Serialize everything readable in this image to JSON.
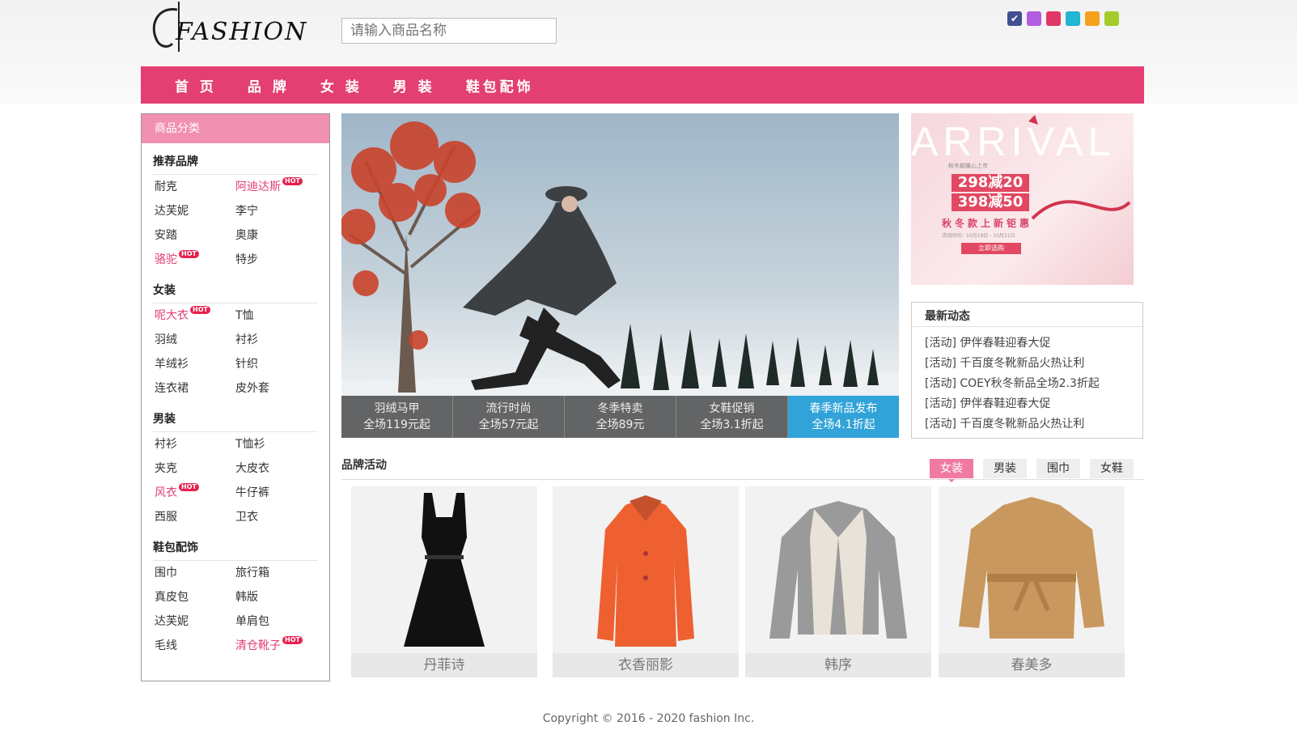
{
  "logo": {
    "text": "FASHION"
  },
  "search": {
    "placeholder": "请输入商品名称"
  },
  "skins": [
    {
      "name": "navy",
      "color": "#3f4f8f"
    },
    {
      "name": "purple",
      "color": "#b35de0"
    },
    {
      "name": "pink",
      "color": "#e23769"
    },
    {
      "name": "cyan",
      "color": "#21b6d1"
    },
    {
      "name": "orange",
      "color": "#f5a11d"
    },
    {
      "name": "green",
      "color": "#a3cc2a"
    }
  ],
  "nav": [
    "首 页",
    "品 牌",
    "女 装",
    "男 装",
    "鞋包配饰"
  ],
  "sidebar": {
    "heading": "商品分类",
    "categories": [
      {
        "title": "推荐品牌",
        "items": [
          {
            "label": "耐克",
            "hot": false
          },
          {
            "label": "阿迪达斯",
            "hot": true
          },
          {
            "label": "达芙妮",
            "hot": false
          },
          {
            "label": "李宁",
            "hot": false
          },
          {
            "label": "安踏",
            "hot": false
          },
          {
            "label": "奥康",
            "hot": false
          },
          {
            "label": "骆驼",
            "hot": true
          },
          {
            "label": "特步",
            "hot": false
          }
        ]
      },
      {
        "title": "女装",
        "items": [
          {
            "label": "呢大衣",
            "hot": true
          },
          {
            "label": "T恤",
            "hot": false
          },
          {
            "label": "羽绒",
            "hot": false
          },
          {
            "label": "衬衫",
            "hot": false
          },
          {
            "label": "羊绒衫",
            "hot": false
          },
          {
            "label": "针织",
            "hot": false
          },
          {
            "label": "连衣裙",
            "hot": false
          },
          {
            "label": "皮外套",
            "hot": false
          }
        ]
      },
      {
        "title": "男装",
        "items": [
          {
            "label": "衬衫",
            "hot": false
          },
          {
            "label": "T恤衫",
            "hot": false
          },
          {
            "label": "夹克",
            "hot": false
          },
          {
            "label": "大皮衣",
            "hot": false
          },
          {
            "label": "风衣",
            "hot": true
          },
          {
            "label": "牛仔裤",
            "hot": false
          },
          {
            "label": "西服",
            "hot": false
          },
          {
            "label": "卫衣",
            "hot": false
          }
        ]
      },
      {
        "title": "鞋包配饰",
        "items": [
          {
            "label": "围巾",
            "hot": false
          },
          {
            "label": "旅行箱",
            "hot": false
          },
          {
            "label": "真皮包",
            "hot": false
          },
          {
            "label": "韩版",
            "hot": false
          },
          {
            "label": "达芙妮",
            "hot": false
          },
          {
            "label": "单肩包",
            "hot": false
          },
          {
            "label": "毛线",
            "hot": false
          },
          {
            "label": "清仓靴子",
            "hot": true
          }
        ]
      }
    ],
    "hot_label": "HOT"
  },
  "banner": {
    "tabs": [
      {
        "line1": "羽绒马甲",
        "line2": "全场119元起",
        "active": false
      },
      {
        "line1": "流行时尚",
        "line2": "全场57元起",
        "active": false
      },
      {
        "line1": "冬季特卖",
        "line2": "全场89元",
        "active": false
      },
      {
        "line1": "女鞋促销",
        "line2": "全场3.1折起",
        "active": false
      },
      {
        "line1": "春季新品发布",
        "line2": "全场4.1折起",
        "active": true
      }
    ]
  },
  "promo": {
    "title": "ARRIVAL",
    "tagline": "秋冬款暖心上市",
    "deal1": "298减20",
    "deal2": "398减50",
    "sub": "秋冬款上新钜惠",
    "dates": "活动时间：10月18日 - 10月31日",
    "button": "立即选购"
  },
  "news": {
    "title": "最新动态",
    "items": [
      "[活动] 伊伴春鞋迎春大促",
      "[活动] 千百度冬靴新品火热让利",
      "[活动] COEY秋冬新品全场2.3折起",
      "[活动] 伊伴春鞋迎春大促",
      "[活动] 千百度冬靴新品火热让利"
    ]
  },
  "brand": {
    "title": "品牌活动",
    "tabs": [
      {
        "label": "女装",
        "active": true
      },
      {
        "label": "男装",
        "active": false
      },
      {
        "label": "围巾",
        "active": false
      },
      {
        "label": "女鞋",
        "active": false
      }
    ],
    "products": [
      {
        "name": "丹菲诗",
        "type": "black-dress"
      },
      {
        "name": "衣香丽影",
        "type": "orange-coat"
      },
      {
        "name": "韩序",
        "type": "gray-coat"
      },
      {
        "name": "春美多",
        "type": "camel-coat"
      }
    ]
  },
  "footer": {
    "text": "Copyright © 2016 - 2020 fashion Inc."
  }
}
